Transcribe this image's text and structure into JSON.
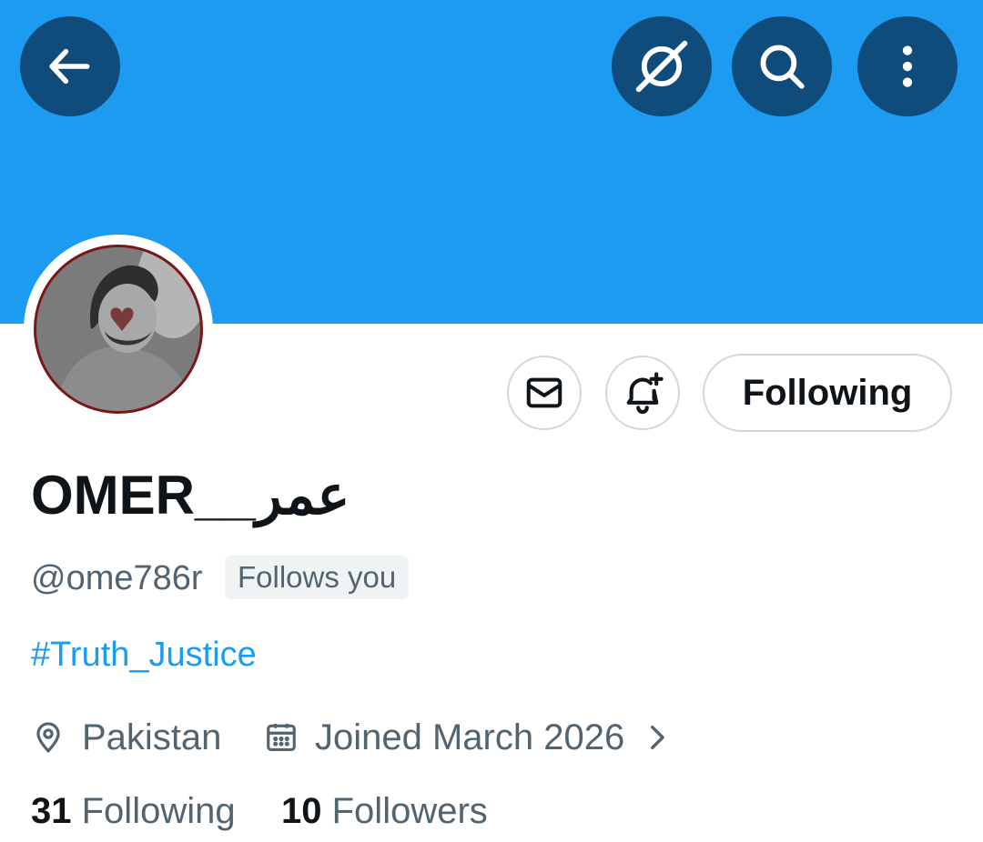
{
  "header": {
    "back_icon": "arrow-left-icon",
    "grok_icon": "grok-icon",
    "search_icon": "search-icon",
    "more_icon": "more-vertical-icon",
    "banner_color": "#1d9bf0"
  },
  "profile": {
    "display_name": "OMER__عمر",
    "handle": "@ome786r",
    "follows_you": "Follows you",
    "bio": "#Truth_Justice",
    "location": "Pakistan",
    "joined": "Joined March 2026"
  },
  "actions": {
    "message_icon": "envelope-icon",
    "notify_icon": "bell-plus-icon",
    "following_label": "Following"
  },
  "stats": {
    "following_count": "31",
    "following_label": "Following",
    "followers_count": "10",
    "followers_label": "Followers"
  }
}
